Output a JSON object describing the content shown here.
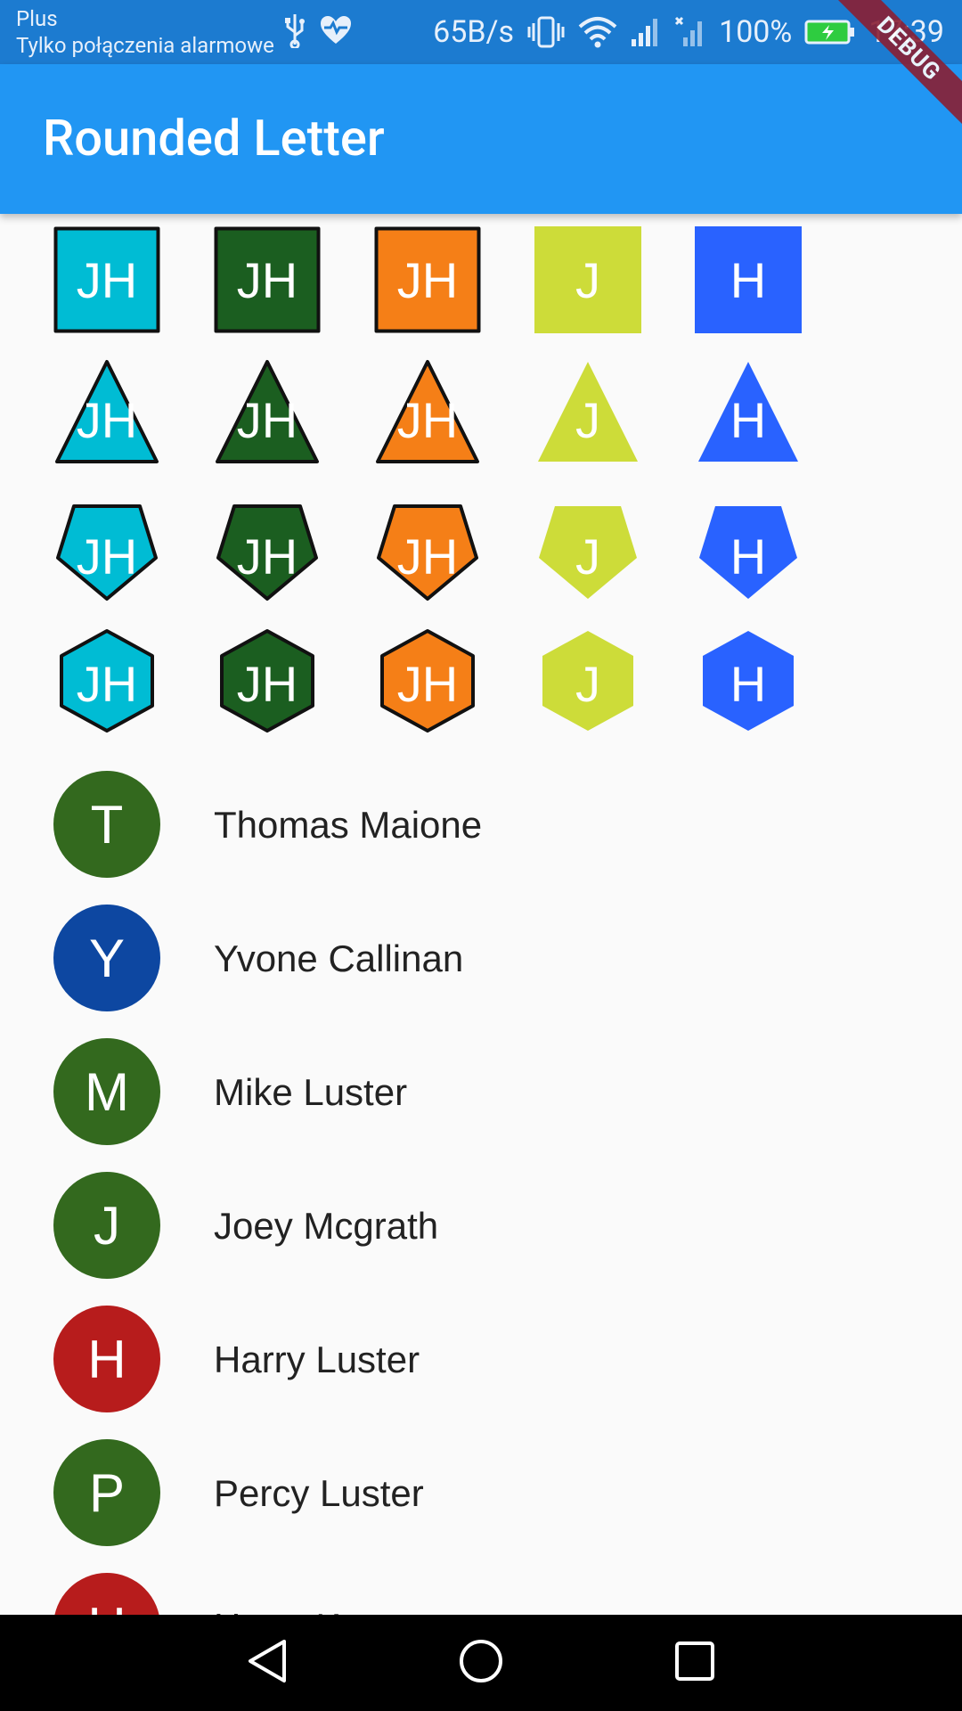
{
  "status_bar": {
    "carrier": "Plus",
    "carrier_sub": "Tylko połączenia alarmowe",
    "net_speed": "65B/s",
    "battery": "100%",
    "time": "17:39"
  },
  "app_bar": {
    "title": "Rounded Letter"
  },
  "debug_banner": "DEBUG",
  "colors": {
    "cyan": "#00bcd4",
    "dark_green": "#1b5e20",
    "orange": "#f57f17",
    "lime": "#cddc39",
    "blue": "#2962ff",
    "app_bar": "#2196f3",
    "status_bar": "#1c7bd0"
  },
  "shape_grid": {
    "rows": [
      {
        "shape": "square",
        "items": [
          {
            "text": "JH",
            "color": "#00bcd4",
            "border": true
          },
          {
            "text": "JH",
            "color": "#1b5e20",
            "border": true
          },
          {
            "text": "JH",
            "color": "#f57f17",
            "border": true
          },
          {
            "text": "J",
            "color": "#cddc39",
            "border": false
          },
          {
            "text": "H",
            "color": "#2962ff",
            "border": false
          }
        ]
      },
      {
        "shape": "triangle",
        "items": [
          {
            "text": "JH",
            "color": "#00bcd4",
            "border": true
          },
          {
            "text": "JH",
            "color": "#1b5e20",
            "border": true
          },
          {
            "text": "JH",
            "color": "#f57f17",
            "border": true
          },
          {
            "text": "J",
            "color": "#cddc39",
            "border": false
          },
          {
            "text": "H",
            "color": "#2962ff",
            "border": false
          }
        ]
      },
      {
        "shape": "pentagon",
        "items": [
          {
            "text": "JH",
            "color": "#00bcd4",
            "border": true
          },
          {
            "text": "JH",
            "color": "#1b5e20",
            "border": true
          },
          {
            "text": "JH",
            "color": "#f57f17",
            "border": true
          },
          {
            "text": "J",
            "color": "#cddc39",
            "border": false
          },
          {
            "text": "H",
            "color": "#2962ff",
            "border": false
          }
        ]
      },
      {
        "shape": "hexagon",
        "items": [
          {
            "text": "JH",
            "color": "#00bcd4",
            "border": true
          },
          {
            "text": "JH",
            "color": "#1b5e20",
            "border": true
          },
          {
            "text": "JH",
            "color": "#f57f17",
            "border": true
          },
          {
            "text": "J",
            "color": "#cddc39",
            "border": false
          },
          {
            "text": "H",
            "color": "#2962ff",
            "border": false
          }
        ]
      }
    ]
  },
  "people": [
    {
      "letter": "T",
      "name": "Thomas Maione",
      "color": "#33691e"
    },
    {
      "letter": "Y",
      "name": "Yvone Callinan",
      "color": "#0d47a1"
    },
    {
      "letter": "M",
      "name": "Mike Luster",
      "color": "#33691e"
    },
    {
      "letter": "J",
      "name": "Joey Mcgrath",
      "color": "#33691e"
    },
    {
      "letter": "H",
      "name": "Harry Luster",
      "color": "#b71c1c"
    },
    {
      "letter": "P",
      "name": "Percy Luster",
      "color": "#33691e"
    },
    {
      "letter": "H",
      "name": "Harry Kasten",
      "color": "#b71c1c"
    }
  ],
  "nav_bar": {
    "back_icon": "back-triangle-icon",
    "home_icon": "home-circle-icon",
    "recents_icon": "recents-square-icon"
  }
}
